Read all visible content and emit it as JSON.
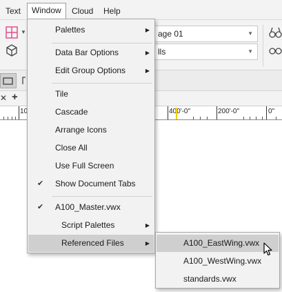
{
  "menubar": {
    "text_label": "Text",
    "window_label": "Window",
    "cloud_label": "Cloud",
    "help_label": "Help"
  },
  "toolbar": {
    "layer_combo_value": "age 01",
    "class_combo_value": "lls"
  },
  "ruler": {
    "label_left": "10",
    "label_400": "400'-0\"",
    "label_200": "200'-0\"",
    "label_right": "0\""
  },
  "window_menu": {
    "palettes": "Palettes",
    "data_bar_options": "Data Bar Options",
    "edit_group_options": "Edit Group Options",
    "tile": "Tile",
    "cascade": "Cascade",
    "arrange_icons": "Arrange Icons",
    "close_all": "Close All",
    "use_full_screen": "Use Full Screen",
    "show_document_tabs": "Show Document Tabs",
    "a100_master": "A100_Master.vwx",
    "script_palettes": "Script Palettes",
    "referenced_files": "Referenced Files",
    "check_glyph": "✔",
    "arrow_glyph": "▶"
  },
  "referenced_files_menu": {
    "items": [
      "A100_EastWing.vwx",
      "A100_WestWing.vwx",
      "standards.vwx"
    ]
  },
  "colors": {
    "menu_bg": "#f2f2f2",
    "highlight": "#cfcfcf",
    "accent_pink": "#e0508c",
    "ruler_marker": "#f2d000"
  }
}
